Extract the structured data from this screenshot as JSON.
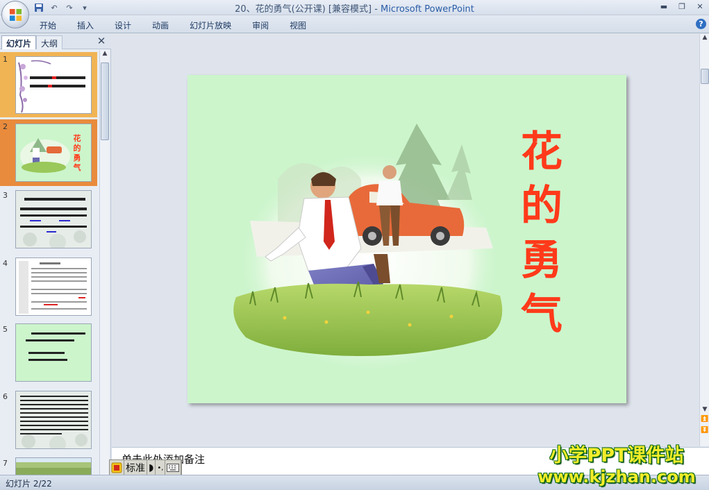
{
  "window": {
    "title_prefix": "20、花的勇气(公开课) [兼容模式] - ",
    "title_app": "Microsoft PowerPoint"
  },
  "ribbon": {
    "tabs": [
      "开始",
      "插入",
      "设计",
      "动画",
      "幻灯片放映",
      "审阅",
      "视图"
    ]
  },
  "left_pane": {
    "tab_slides": "幻灯片",
    "tab_outline": "大纲",
    "slides": [
      {
        "number": "1"
      },
      {
        "number": "2",
        "title": "花的勇气"
      },
      {
        "number": "3"
      },
      {
        "number": "4"
      },
      {
        "number": "5"
      },
      {
        "number": "6"
      },
      {
        "number": "7"
      }
    ]
  },
  "slide": {
    "title": "花的勇气"
  },
  "notes": {
    "placeholder": "单击此处添加备注"
  },
  "status": {
    "slide_counter": "幻灯片 2/22"
  },
  "ime": {
    "mode": "标准"
  },
  "watermark": {
    "line1": "小学PPT课件站",
    "line2": "www.kjzhan.com"
  },
  "colors": {
    "slide_bg": "#ccf5cc",
    "title_red": "#ff3a1a",
    "selected_thumb": "#e98b3c"
  }
}
